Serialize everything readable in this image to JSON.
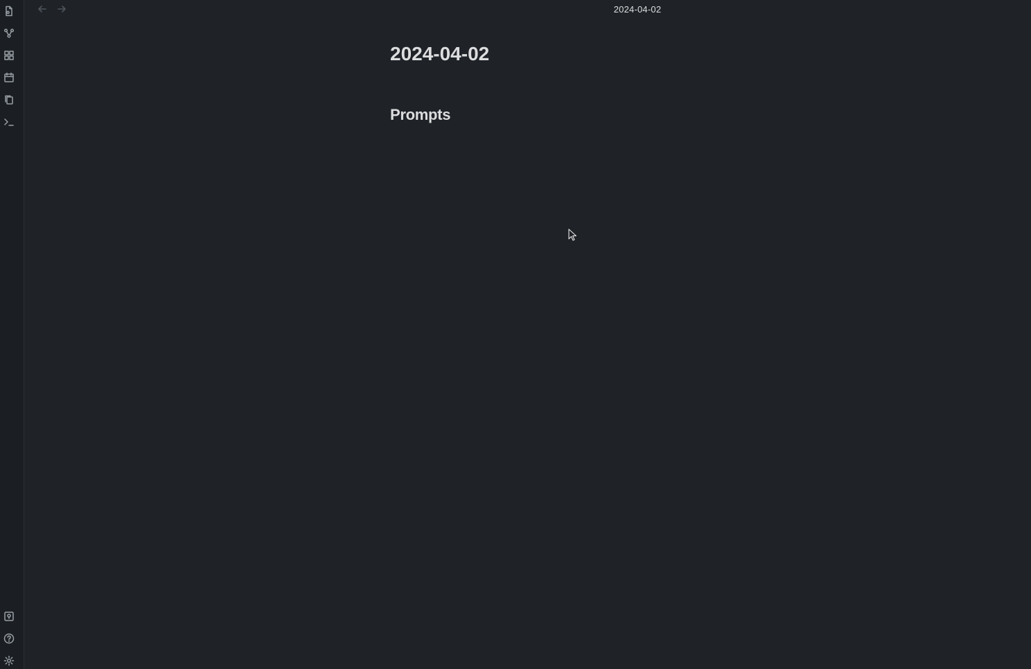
{
  "ribbon": {
    "top_icons": [
      "file-icon",
      "graph-icon",
      "grid-icon",
      "calendar-icon",
      "copy-icon",
      "terminal-icon"
    ],
    "bottom_icons": [
      "vault-icon",
      "help-icon",
      "settings-icon"
    ]
  },
  "header": {
    "title": "2024-04-02"
  },
  "note": {
    "title": "2024-04-02",
    "heading": "Prompts"
  },
  "colors": {
    "background": "#1f2328",
    "text": "#dcddde",
    "icon": "#9aa0a7"
  }
}
